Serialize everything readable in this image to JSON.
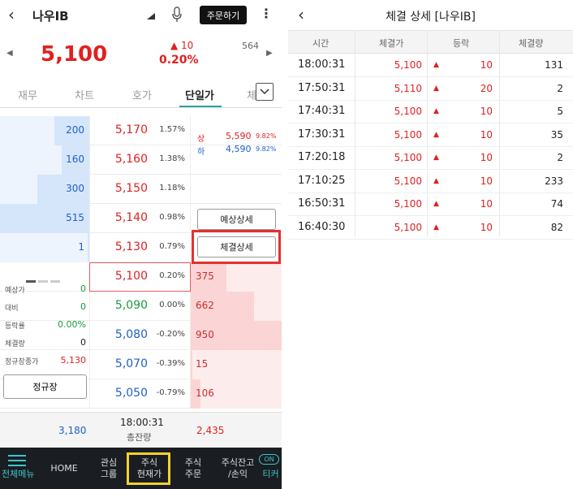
{
  "stock": {
    "name": "나우IB",
    "order_button": "주문하기",
    "price": "5,100",
    "change": "▲ 10",
    "change_pct": "0.20%",
    "volume": "564"
  },
  "tabs": [
    "재무",
    "차트",
    "호가",
    "단일가",
    "체"
  ],
  "tabs_active": "단일가",
  "orderbook": {
    "asks": [
      {
        "qty": "200",
        "price": "5,170",
        "pct": "1.57%",
        "fill": 0.39
      },
      {
        "qty": "160",
        "price": "5,160",
        "pct": "1.38%",
        "fill": 0.31
      },
      {
        "qty": "300",
        "price": "5,150",
        "pct": "1.18%",
        "fill": 0.58
      },
      {
        "qty": "515",
        "price": "5,140",
        "pct": "0.98%",
        "fill": 1.0
      },
      {
        "qty": "1",
        "price": "5,130",
        "pct": "0.79%",
        "fill": 0.02
      }
    ],
    "bids": [
      {
        "qty": "375",
        "price": "5,100",
        "pct": "0.20%",
        "color": "red",
        "fill": 0.39
      },
      {
        "qty": "662",
        "price": "5,090",
        "pct": "0.00%",
        "color": "green",
        "fill": 0.7
      },
      {
        "qty": "950",
        "price": "5,080",
        "pct": "-0.20%",
        "color": "blue",
        "fill": 1.0
      },
      {
        "qty": "15",
        "price": "5,070",
        "pct": "-0.39%",
        "color": "blue",
        "fill": 0.02
      },
      {
        "qty": "106",
        "price": "5,050",
        "pct": "-0.79%",
        "color": "blue",
        "fill": 0.11
      }
    ]
  },
  "limits": {
    "upper_label": "상",
    "upper_price": "5,590",
    "upper_pct": "9.82%",
    "lower_label": "하",
    "lower_price": "4,590",
    "lower_pct": "9.82%"
  },
  "side_buttons": {
    "expected": "예상상세",
    "trade": "체결상세"
  },
  "info": [
    {
      "label": "예상가",
      "value": "0",
      "color": "green"
    },
    {
      "label": "대비",
      "value": "0",
      "color": "green"
    },
    {
      "label": "등락률",
      "value": "0.00%",
      "color": "green"
    },
    {
      "label": "체결량",
      "value": "0",
      "color": "dark"
    },
    {
      "label": "정규장종가",
      "value": "5,130",
      "color": "red"
    }
  ],
  "regular_button": "정규장",
  "summary": {
    "ask_total": "3,180",
    "time": "18:00:31",
    "time_label": "총잔량",
    "bid_total": "2,435"
  },
  "bottom_nav": {
    "menu": "전체메뉴",
    "home": "HOME",
    "interest_1": "관심",
    "interest_2": "그룹",
    "current_1": "주식",
    "current_2": "현재가",
    "order_1": "주식",
    "order_2": "주문",
    "balance_1": "주식잔고",
    "balance_2": "/손익",
    "ticker": "티커",
    "ticker_badge": "ON"
  },
  "detail": {
    "title": "체결 상세  [나우IB]",
    "headers": {
      "time": "시간",
      "price": "체결가",
      "change": "등락",
      "qty": "체결량"
    },
    "rows": [
      {
        "time": "18:00:31",
        "price": "5,100",
        "change": "10",
        "qty": "131"
      },
      {
        "time": "17:50:31",
        "price": "5,110",
        "change": "20",
        "qty": "2"
      },
      {
        "time": "17:40:31",
        "price": "5,100",
        "change": "10",
        "qty": "5"
      },
      {
        "time": "17:30:31",
        "price": "5,100",
        "change": "10",
        "qty": "35"
      },
      {
        "time": "17:20:18",
        "price": "5,100",
        "change": "10",
        "qty": "2"
      },
      {
        "time": "17:10:25",
        "price": "5,100",
        "change": "10",
        "qty": "233"
      },
      {
        "time": "16:50:31",
        "price": "5,100",
        "change": "10",
        "qty": "74"
      },
      {
        "time": "16:40:30",
        "price": "5,100",
        "change": "10",
        "qty": "82"
      }
    ]
  },
  "icons": {
    "up_arrow": "▲",
    "back": "back-chevron-icon"
  }
}
